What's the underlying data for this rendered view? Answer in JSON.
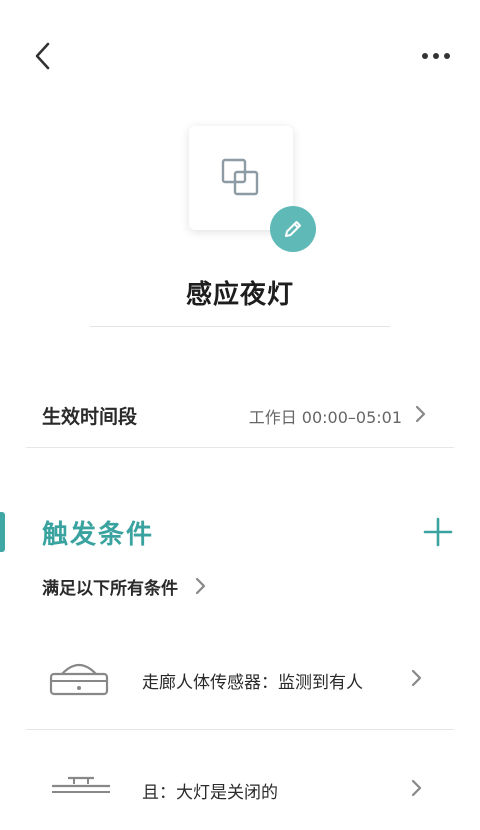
{
  "header": {
    "back_icon": "chevron-left-icon",
    "more_icon": "more-horizontal-icon"
  },
  "scene": {
    "icon": "overlap-squares-icon",
    "edit_icon": "pencil-icon",
    "accent_color": "#5fbab7",
    "title": "感应夜灯"
  },
  "time_period": {
    "label": "生效时间段",
    "value": "工作日 00:00–05:01"
  },
  "triggers": {
    "title": "触发条件",
    "title_color": "#3aa3a0",
    "mode_label": "满足以下所有条件",
    "conditions": [
      {
        "icon": "motion-sensor-icon",
        "text": "走廊人体传感器：监测到有人"
      },
      {
        "icon": "ceiling-light-icon",
        "text": "且：大灯是关闭的"
      }
    ]
  }
}
